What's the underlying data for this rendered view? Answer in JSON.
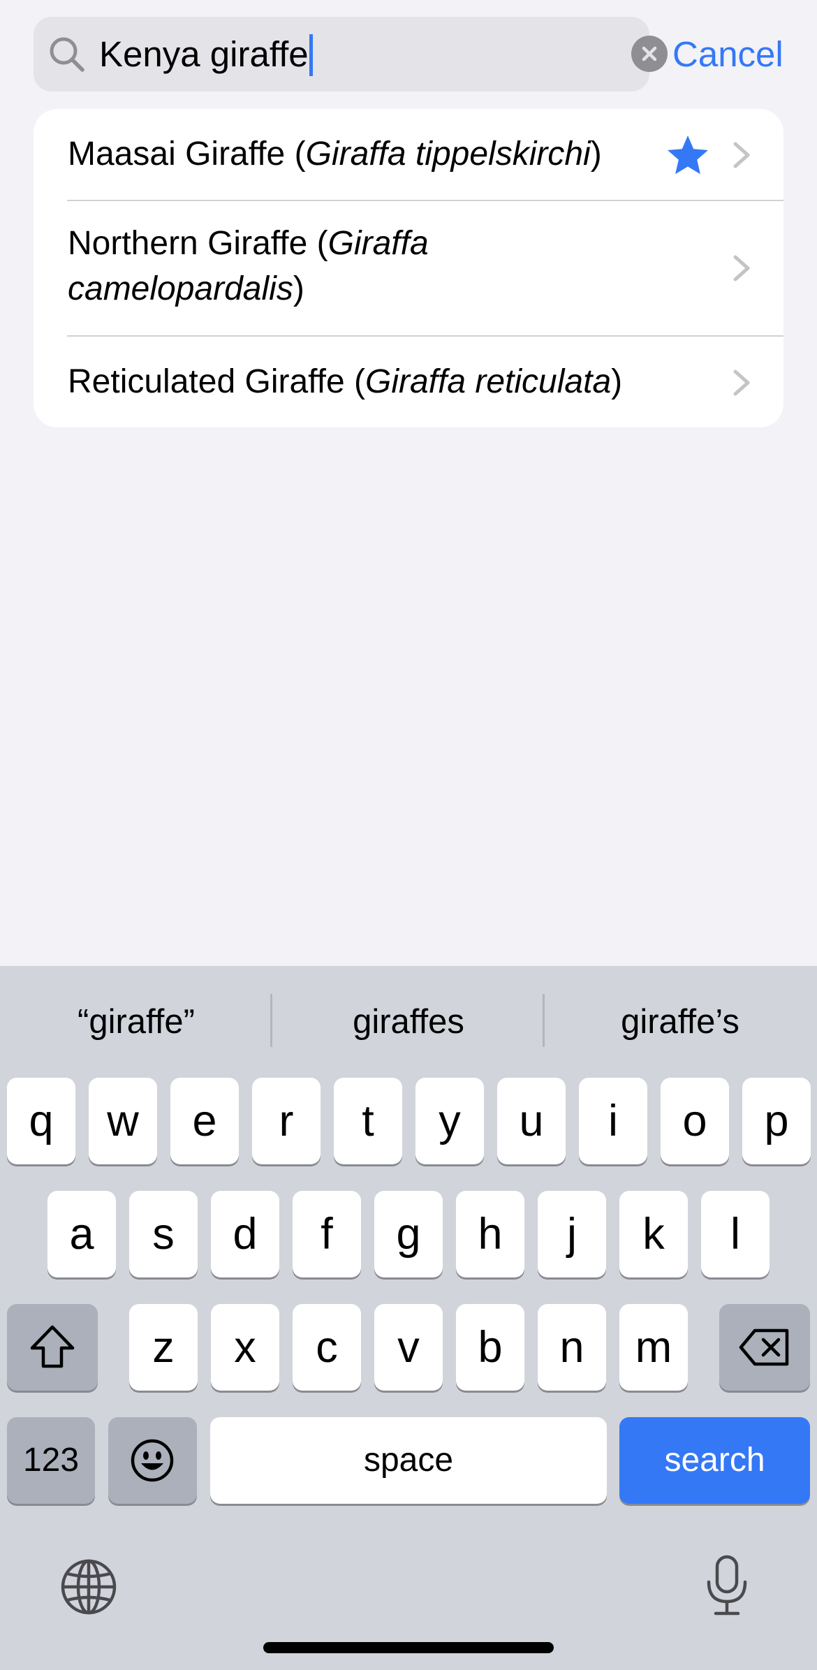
{
  "search": {
    "query": "Kenya giraffe",
    "cancel_label": "Cancel"
  },
  "results": [
    {
      "common": "Maasai Giraffe (",
      "scientific": "Giraffa tippelskirchi",
      "close": ")",
      "favorited": true
    },
    {
      "common": "Northern Giraffe (",
      "scientific_line1": "Giraffa",
      "scientific_line2": "camelopardalis",
      "close": ")",
      "favorited": false
    },
    {
      "common": "Reticulated Giraffe (",
      "scientific": "Giraffa reticulata",
      "close": ")",
      "favorited": false
    }
  ],
  "keyboard": {
    "suggestions": [
      "“giraffe”",
      "giraffes",
      "giraffe’s"
    ],
    "row1": [
      "q",
      "w",
      "e",
      "r",
      "t",
      "y",
      "u",
      "i",
      "o",
      "p"
    ],
    "row2": [
      "a",
      "s",
      "d",
      "f",
      "g",
      "h",
      "j",
      "k",
      "l"
    ],
    "row3": [
      "z",
      "x",
      "c",
      "v",
      "b",
      "n",
      "m"
    ],
    "numbers_label": "123",
    "space_label": "space",
    "search_label": "search"
  },
  "colors": {
    "accent": "#3478f6",
    "background": "#f2f2f7",
    "keyboard_bg": "#d1d4db"
  }
}
